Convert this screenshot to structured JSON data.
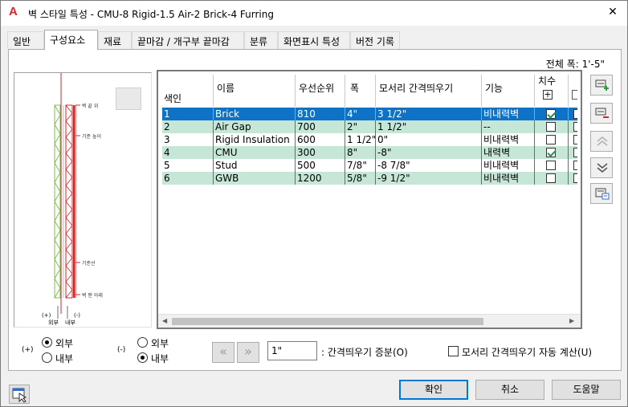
{
  "window": {
    "title": "벽 스타일 특성 - CMU-8 Rigid-1.5 Air-2 Brick-4 Furring",
    "close": "✕",
    "app_icon": "A"
  },
  "tabs": [
    {
      "label": "일반"
    },
    {
      "label": "구성요소",
      "active": true
    },
    {
      "label": "재료"
    },
    {
      "label": "끝마감 / 개구부 끝마감"
    },
    {
      "label": "분류"
    },
    {
      "label": "화면표시 특성"
    },
    {
      "label": "버전 기록"
    }
  ],
  "total_width": "전체 폭: 1'-5\"",
  "preview": {
    "labels": [
      "벽 끝 위",
      "기준 높이",
      "기준선",
      "벽 맨 아래"
    ],
    "sign_plus": "(+)",
    "sign_minus": "(-)",
    "outside": "외부",
    "inside": "내부"
  },
  "grid": {
    "headers": {
      "index": "색인",
      "name": "이름",
      "priority": "우선순위",
      "width": "폭",
      "offset": "모서리 간격띄우기",
      "function": "기능",
      "dim": "치수"
    },
    "rows": [
      {
        "index": "1",
        "name": "Brick",
        "priority": "810",
        "width": "4\"",
        "offset": "3 1/2\"",
        "function": "비내력벽",
        "dim": true,
        "selected": true
      },
      {
        "index": "2",
        "name": "Air Gap",
        "priority": "700",
        "width": "2\"",
        "offset": "1 1/2\"",
        "function": "--",
        "dim": false
      },
      {
        "index": "3",
        "name": "Rigid Insulation",
        "priority": "600",
        "width": "1 1/2\"",
        "offset": "0\"",
        "function": "비내력벽",
        "dim": false
      },
      {
        "index": "4",
        "name": "CMU",
        "priority": "300",
        "width": "8\"",
        "offset": "-8\"",
        "function": "내력벽",
        "dim": true
      },
      {
        "index": "5",
        "name": "Stud",
        "priority": "500",
        "width": "7/8\"",
        "offset": "-8 7/8\"",
        "function": "비내력벽",
        "dim": false
      },
      {
        "index": "6",
        "name": "GWB",
        "priority": "1200",
        "width": "5/8\"",
        "offset": "-9 1/2\"",
        "function": "비내력벽",
        "dim": false
      }
    ]
  },
  "options": {
    "plus_sign": "(+)",
    "minus_sign": "(-)",
    "plus_outside": "외부",
    "plus_inside": "내부",
    "minus_outside": "외부",
    "minus_inside": "내부",
    "plus_selected": "외부",
    "minus_selected": "내부",
    "increment_value": "1\"",
    "increment_label": ": 간격띄우기 증분(O)",
    "auto_calc_label": "모서리 간격띄우기 자동 계산(U)",
    "auto_calc_checked": false
  },
  "buttons": {
    "ok": "확인",
    "cancel": "취소",
    "help": "도움말"
  },
  "colors": {
    "selection": "#0e73c6",
    "row_alt": "#c6e7d8",
    "wall_red": "#e02020",
    "wall_green": "#7cc04a",
    "accent": "#0078d7"
  }
}
